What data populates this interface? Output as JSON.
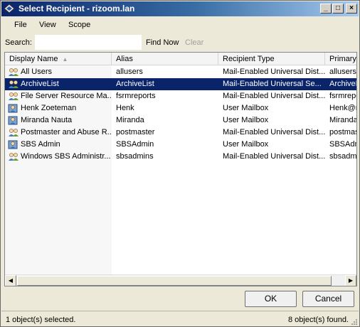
{
  "window": {
    "title": "Select Recipient - rizoom.lan",
    "minimize": "_",
    "maximize": "□",
    "close": "×"
  },
  "menu": [
    "File",
    "View",
    "Scope"
  ],
  "search": {
    "label": "Search:",
    "value": "",
    "placeholder": "",
    "find_now": "Find Now",
    "clear": "Clear"
  },
  "columns": [
    "Display Name",
    "Alias",
    "Recipient Type",
    "Primary"
  ],
  "rows": [
    {
      "name": "All Users",
      "alias": "allusers",
      "type": "Mail-Enabled Universal Dist...",
      "primary": "allusers@",
      "icon": "group-icon",
      "selected": false
    },
    {
      "name": "ArchiveList",
      "alias": "ArchiveList",
      "type": "Mail-Enabled Universal Se...",
      "primary": "ArchiveLi",
      "icon": "group-icon",
      "selected": true
    },
    {
      "name": "File Server Resource Ma...",
      "alias": "fsrmreports",
      "type": "Mail-Enabled Universal Dist...",
      "primary": "fsrmrepo",
      "icon": "group-icon",
      "selected": false
    },
    {
      "name": "Henk Zoeteman",
      "alias": "Henk",
      "type": "User Mailbox",
      "primary": "Henk@r",
      "icon": "user-icon",
      "selected": false
    },
    {
      "name": "Miranda Nauta",
      "alias": "Miranda",
      "type": "User Mailbox",
      "primary": "Miranda",
      "icon": "user-icon",
      "selected": false
    },
    {
      "name": "Postmaster and Abuse R...",
      "alias": "postmaster",
      "type": "Mail-Enabled Universal Dist...",
      "primary": "postmas",
      "icon": "group-icon",
      "selected": false
    },
    {
      "name": "SBS Admin",
      "alias": "SBSAdmin",
      "type": "User Mailbox",
      "primary": "SBSAdm",
      "icon": "user-icon",
      "selected": false
    },
    {
      "name": "Windows SBS Administr...",
      "alias": "sbsadmins",
      "type": "Mail-Enabled Universal Dist...",
      "primary": "sbsadmi",
      "icon": "group-icon",
      "selected": false
    }
  ],
  "buttons": {
    "ok": "OK",
    "cancel": "Cancel"
  },
  "status": {
    "left": "1 object(s) selected.",
    "right": "8 object(s) found."
  },
  "colors": {
    "selection": "#0a246a",
    "title_start": "#0a246a",
    "title_end": "#a6caf0"
  }
}
